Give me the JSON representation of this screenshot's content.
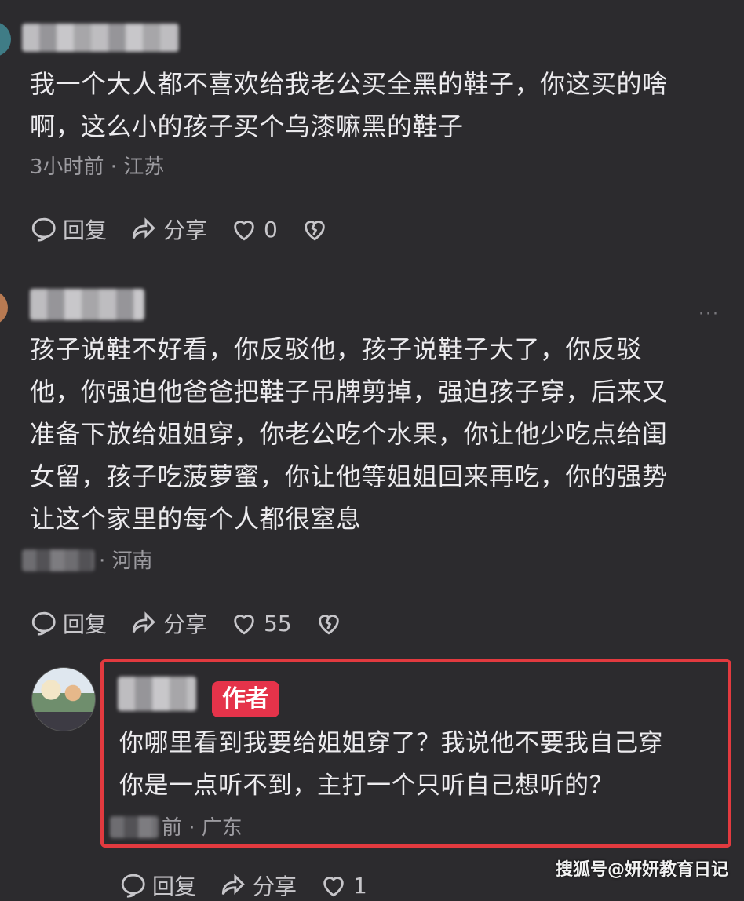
{
  "comments": [
    {
      "text": "我一个大人都不喜欢给我老公买全黑的鞋子，你这买的啥\n啊，这么小的孩子买个乌漆嘛黑的鞋子",
      "meta": "3小时前 · 江苏",
      "reply_label": "回复",
      "share_label": "分享",
      "likes": "0"
    },
    {
      "text": "孩子说鞋不好看，你反驳他，孩子说鞋子大了，你反驳\n他，你强迫他爸爸把鞋子吊牌剪掉，强迫孩子穿，后来又\n准备下放给姐姐穿，你老公吃个水果，你让他少吃点给闺\n女留，孩子吃菠萝蜜，你让他等姐姐回来再吃，你的强势\n让这个家里的每个人都很窒息",
      "meta": "· 河南",
      "reply_label": "回复",
      "share_label": "分享",
      "likes": "55",
      "more": "···"
    },
    {
      "badge": "作者",
      "text": "你哪里看到我要给姐姐穿了？我说他不要我自己穿\n你是一点听不到，主打一个只听自己想听的？",
      "meta": "前 · 广东",
      "reply_label": "回复",
      "share_label": "分享",
      "likes": "1"
    }
  ],
  "watermark": "搜狐号@妍妍教育日记",
  "colors": {
    "highlight": "#e23a3f",
    "badge": "#e5334a",
    "background": "#2c2b2e"
  }
}
